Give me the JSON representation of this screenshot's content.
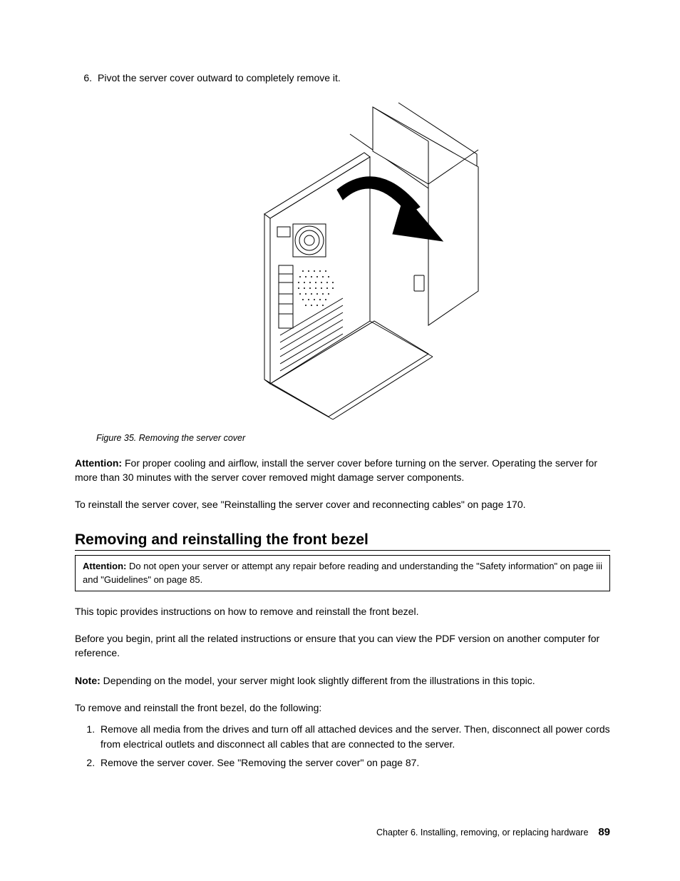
{
  "step6": {
    "number": "6.",
    "text": "Pivot the server cover outward to completely remove it."
  },
  "figure": {
    "number": "Figure 35.",
    "caption": "Removing the server cover"
  },
  "attention_para": {
    "label": "Attention:",
    "text": " For proper cooling and airflow, install the server cover before turning on the server. Operating the server for more than 30 minutes with the server cover removed might damage server components."
  },
  "reinstall_para": "To reinstall the server cover, see \"Reinstalling the server cover and reconnecting cables\" on page 170.",
  "section_title": "Removing and reinstalling the front bezel",
  "section_attention": {
    "label": "Attention:",
    "text": " Do not open your server or attempt any repair before reading and understanding the \"Safety information\" on page iii and \"Guidelines\" on page 85."
  },
  "intro_para": "This topic provides instructions on how to remove and reinstall the front bezel.",
  "before_para": "Before you begin, print all the related instructions or ensure that you can view the PDF version on another computer for reference.",
  "note_para": {
    "label": "Note:",
    "text": " Depending on the model, your server might look slightly different from the illustrations in this topic."
  },
  "procedure_intro": "To remove and reinstall the front bezel, do the following:",
  "steps": [
    "Remove all media from the drives and turn off all attached devices and the server. Then, disconnect all power cords from electrical outlets and disconnect all cables that are connected to the server.",
    "Remove the server cover. See \"Removing the server cover\" on page 87."
  ],
  "footer": {
    "chapter": "Chapter 6. Installing, removing, or replacing hardware",
    "page": "89"
  }
}
